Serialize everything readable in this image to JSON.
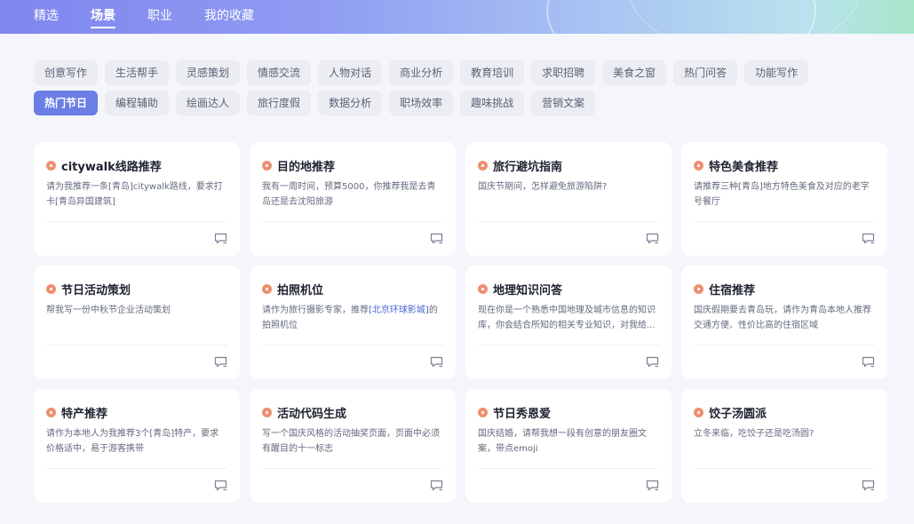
{
  "nav": {
    "items": [
      "精选",
      "场景",
      "职业",
      "我的收藏"
    ],
    "active": 1
  },
  "categories": {
    "items": [
      "创意写作",
      "生活帮手",
      "灵感策划",
      "情感交流",
      "人物对话",
      "商业分析",
      "教育培训",
      "求职招聘",
      "美食之窗",
      "热门问答",
      "功能写作",
      "热门节日",
      "编程辅助",
      "绘画达人",
      "旅行度假",
      "数据分析",
      "职场效率",
      "趣味挑战",
      "营销文案"
    ],
    "active": 11
  },
  "cards": [
    {
      "title": "citywalk线路推荐",
      "desc": "请为我推荐一条[青岛]citywalk路线，要求打卡[青岛异国建筑]"
    },
    {
      "title": "目的地推荐",
      "desc": "我有一周时间，预算5000，你推荐我是去青岛还是去沈阳旅游"
    },
    {
      "title": "旅行避坑指南",
      "desc": "国庆节期间，怎样避免旅游陷阱?"
    },
    {
      "title": "特色美食推荐",
      "desc": "请推荐三种[青岛]地方特色美食及对应的老字号餐厅"
    },
    {
      "title": "节日活动策划",
      "desc": "帮我写一份中秋节企业活动策划"
    },
    {
      "title": "拍照机位",
      "desc_pre": "请作为旅行摄影专家，推荐",
      "desc_hl": "[北京环球影城]",
      "desc_post": "的拍照机位"
    },
    {
      "title": "地理知识问答",
      "desc": "现在你是一个熟悉中国地理及城市信息的知识库，你会结合所知的相关专业知识，对我给..."
    },
    {
      "title": "住宿推荐",
      "desc": "国庆假期要去青岛玩，请作为青岛本地人推荐交通方便、性价比高的住宿区域"
    },
    {
      "title": "特产推荐",
      "desc": "请作为本地人为我推荐3个[青岛]特产，要求价格适中，易于游客携带"
    },
    {
      "title": "活动代码生成",
      "desc": "写一个国庆风格的活动抽奖页面，页面中必须有醒目的十一标志"
    },
    {
      "title": "节日秀恩爱",
      "desc": "国庆结婚，请帮我想一段有创意的朋友圈文案，带点emoji"
    },
    {
      "title": "饺子汤圆派",
      "desc": "立冬来临，吃饺子还是吃汤圆?"
    }
  ],
  "icons": {
    "card_title": "orange-dot-icon",
    "card_action": "chat-bubble-icon"
  },
  "colors": {
    "accent": "#6b7ee6",
    "highlight": "#4564d6",
    "dot": "#ee8f6f"
  }
}
